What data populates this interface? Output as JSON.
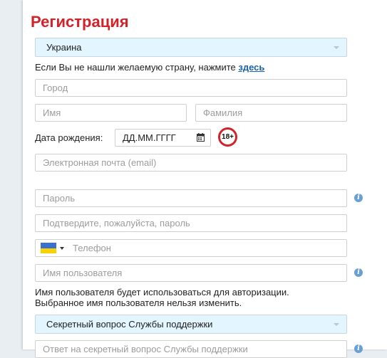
{
  "form": {
    "title": "Регистрация",
    "country": {
      "selected": "Украина"
    },
    "country_hint": {
      "text": "Если Вы не нашли желаемую страну, нажмите ",
      "link": "здесь"
    },
    "city": {
      "placeholder": "Город"
    },
    "first_name": {
      "placeholder": "Имя"
    },
    "last_name": {
      "placeholder": "Фамилия"
    },
    "birth_date": {
      "label": "Дата рождения:",
      "placeholder": "ДД.ММ.ГГГГ",
      "age_badge": "18+"
    },
    "email": {
      "placeholder": "Электронная почта (email)"
    },
    "password": {
      "placeholder": "Пароль"
    },
    "password_confirm": {
      "placeholder": "Подтвердите, пожалуйста, пароль"
    },
    "phone": {
      "placeholder": "Телефон",
      "country_flag": "ukraine-flag-icon"
    },
    "username": {
      "placeholder": "Имя пользователя",
      "hint_line1": "Имя пользователя будет использоваться для авторизации.",
      "hint_line2": "Выбранное имя пользователя нельзя изменить."
    },
    "secret_question": {
      "selected": "Секретный вопрос Службы поддержки"
    },
    "secret_answer": {
      "placeholder": "Ответ на секретный вопрос Службы поддержки"
    },
    "info_icon_glyph": "i"
  },
  "colors": {
    "title": "#d1232a",
    "link": "#1a63a8",
    "select_background": "#e3f5ff",
    "info_icon": "#6a9fd0",
    "age_badge_ring": "#d1232a"
  }
}
